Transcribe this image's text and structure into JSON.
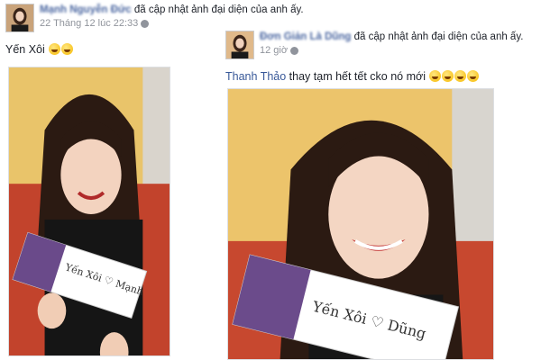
{
  "posts": [
    {
      "author": "Mạnh Nguyễn Đức",
      "action": "đã cập nhật ảnh đại diện của anh ấy.",
      "timestamp": "22 Tháng 12 lúc 22:33",
      "privacy_icon": "globe-icon",
      "caption": "Yến Xôi",
      "emoji": [
        "grinning-sweat-emoji",
        "grinning-sweat-emoji"
      ],
      "photo": {
        "card_text": "Yến Xôi ♡ Mạnh"
      }
    },
    {
      "author": "Đơn Giản Là Dũng",
      "action": "đã cập nhật ảnh đại diện của anh ấy.",
      "timestamp": "12 giờ",
      "privacy_icon": "globe-icon",
      "caption_mention": "Thanh Thảo",
      "caption": "thay tạm hết tết cko nó mới",
      "emoji": [
        "laughing-tears-emoji",
        "laughing-tears-emoji",
        "laughing-tears-emoji",
        "laughing-tears-emoji"
      ],
      "photo": {
        "card_text": "Yến Xôi ♡ Dũng"
      }
    }
  ]
}
